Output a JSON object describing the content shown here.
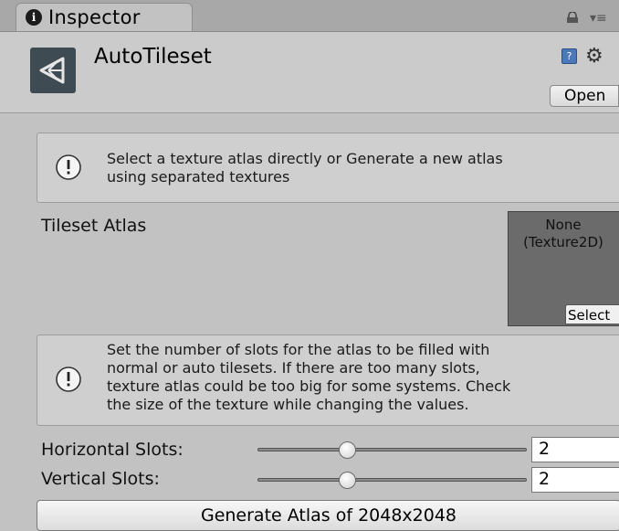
{
  "tab": {
    "label": "Inspector",
    "icon": "info-icon"
  },
  "window_controls": {
    "lock": "lock-icon",
    "menu": "context-menu-icon"
  },
  "header": {
    "title": "AutoTileset",
    "open_label": "Open"
  },
  "helpbox_1": {
    "line1": "Select a texture atlas directly or Generate a new atlas",
    "line2": "using separated textures"
  },
  "tileset_atlas": {
    "label": "Tileset Atlas",
    "value_line1": "None",
    "value_line2": "(Texture2D)",
    "select_label": "Select"
  },
  "helpbox_2": {
    "line1": "Set the number of slots for the atlas to be filled with",
    "line2": "normal or auto tilesets. If there are too many slots,",
    "line3": "texture atlas could be too big for some systems. Check",
    "line4": "the size of the texture while changing the values."
  },
  "horizontal_slots": {
    "label": "Horizontal Slots:",
    "value": "2"
  },
  "vertical_slots": {
    "label": "Vertical Slots:",
    "value": "2"
  },
  "generate": {
    "label": "Generate Atlas of 2048x2048"
  },
  "colors": {
    "panel_bg": "#c2c2c2",
    "tab_bar": "#a8a8a8",
    "texture_slot": "#6b6b6b",
    "asset_icon_bg": "#3f4b52"
  }
}
